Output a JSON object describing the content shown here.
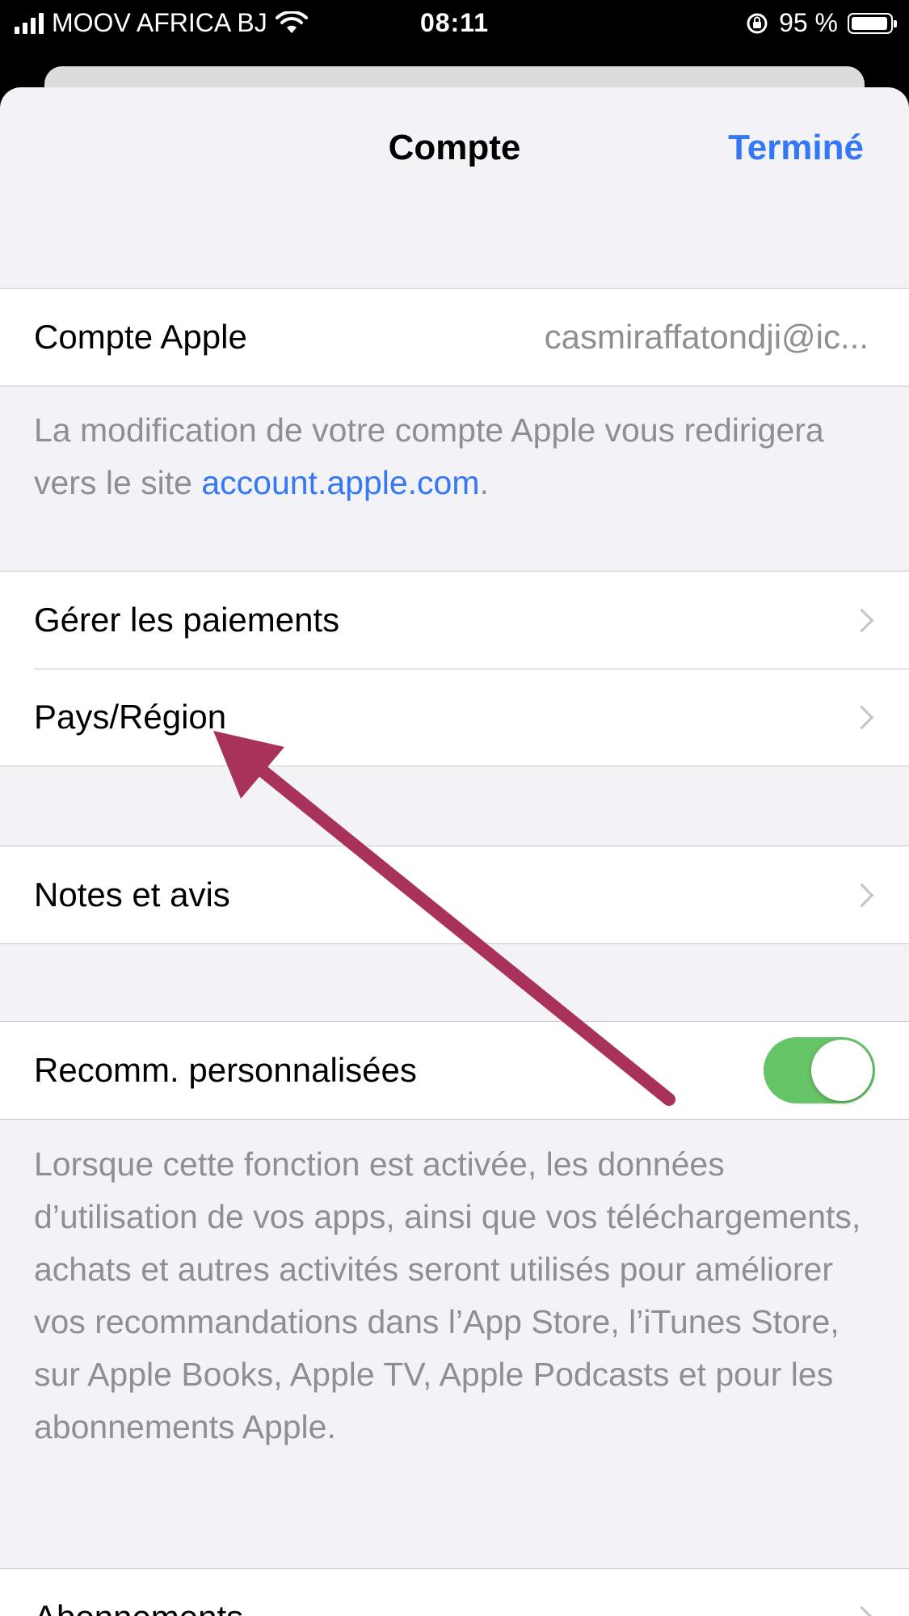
{
  "status_bar": {
    "carrier": "MOOV AFRICA BJ",
    "time": "08:11",
    "battery": "95 %",
    "icons": [
      "signal-icon",
      "wifi-icon",
      "rotation-lock-icon",
      "battery-icon"
    ]
  },
  "nav": {
    "title": "Compte",
    "done_label": "Terminé"
  },
  "apple_account": {
    "label": "Compte Apple",
    "value": "casmiraffatondji@ic..."
  },
  "account_note": {
    "text": "La modification de votre compte Apple vous redirigera vers le site ",
    "link": "account.apple.com",
    "suffix": "."
  },
  "menu": {
    "payments": "Gérer les paiements",
    "country": "Pays/Région",
    "ratings": "Notes et avis"
  },
  "recommendations": {
    "label": "Recomm. personnalisées",
    "enabled": true,
    "description": "Lorsque cette fonction est activée, les données d’utilisation de vos apps, ainsi que vos téléchargements, achats et autres activités seront utilisés pour améliorer vos recommandations dans l’App Store, l’iTunes Store, sur Apple Books, Apple TV, Apple Podcasts et pour les abonnements Apple."
  },
  "subscriptions": {
    "label": "Abonnements"
  },
  "colors": {
    "accent": "#3478f6",
    "toggle_on": "#65c466",
    "annotation_arrow": "#a8325a"
  }
}
